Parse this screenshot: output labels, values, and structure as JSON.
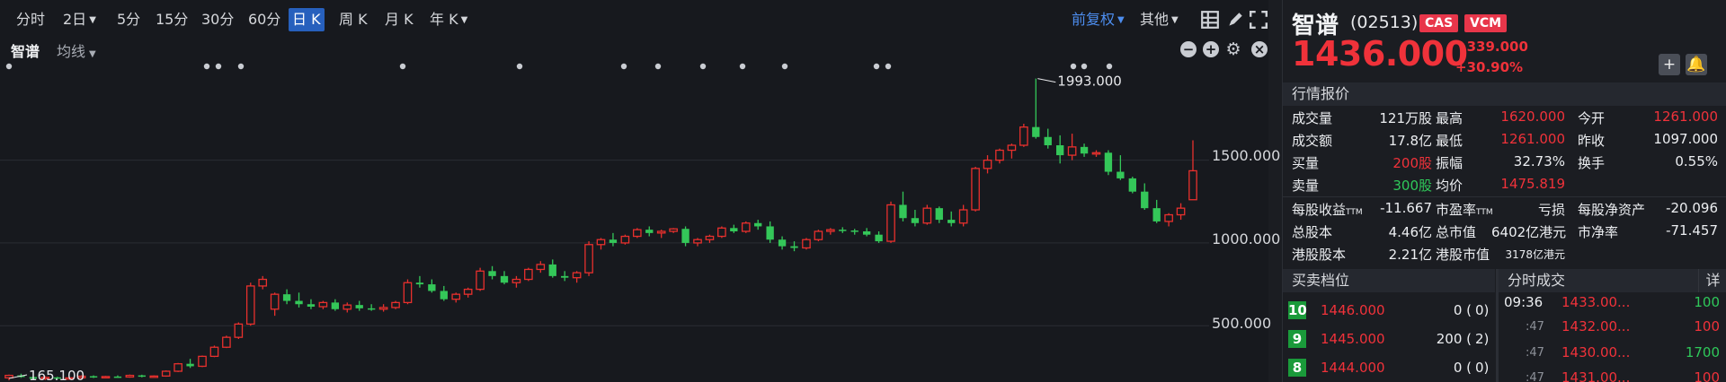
{
  "toolbar": {
    "timeframes": [
      "分时",
      "2日",
      "5分",
      "15分",
      "30分",
      "60分",
      "日 K",
      "周 K",
      "月 K",
      "年 K"
    ],
    "active": "日 K",
    "adjust_label": "前复权",
    "other_label": "其他"
  },
  "chart_header": {
    "name": "智谱",
    "indicator": "均线"
  },
  "chart_data": {
    "type": "candlestick",
    "y_ticks": [
      "1500.000",
      "1000.000",
      "500.000"
    ],
    "ylim": [
      160,
      2110
    ],
    "max_label": "1993.000",
    "min_label": "165.100",
    "up_color": "#e8302d",
    "down_color": "#34c759",
    "candles": [
      [
        185,
        205,
        170,
        200
      ],
      [
        200,
        210,
        185,
        190
      ],
      [
        190,
        195,
        175,
        180
      ],
      [
        180,
        195,
        172,
        188
      ],
      [
        188,
        192,
        178,
        182
      ],
      [
        182,
        190,
        175,
        185
      ],
      [
        185,
        200,
        180,
        195
      ],
      [
        195,
        200,
        184,
        187
      ],
      [
        187,
        197,
        182,
        193
      ],
      [
        193,
        200,
        186,
        190
      ],
      [
        190,
        205,
        186,
        200
      ],
      [
        200,
        204,
        188,
        192
      ],
      [
        192,
        200,
        188,
        196
      ],
      [
        196,
        230,
        192,
        225
      ],
      [
        225,
        275,
        220,
        270
      ],
      [
        270,
        300,
        245,
        255
      ],
      [
        255,
        320,
        250,
        315
      ],
      [
        315,
        380,
        310,
        370
      ],
      [
        370,
        440,
        365,
        430
      ],
      [
        430,
        520,
        420,
        510
      ],
      [
        510,
        760,
        500,
        740
      ],
      [
        740,
        800,
        720,
        780
      ],
      [
        600,
        700,
        560,
        690
      ],
      [
        690,
        720,
        630,
        650
      ],
      [
        650,
        700,
        610,
        630
      ],
      [
        630,
        660,
        600,
        615
      ],
      [
        615,
        650,
        600,
        640
      ],
      [
        640,
        660,
        590,
        600
      ],
      [
        600,
        640,
        580,
        625
      ],
      [
        625,
        650,
        590,
        605
      ],
      [
        605,
        630,
        590,
        600
      ],
      [
        600,
        630,
        585,
        610
      ],
      [
        610,
        650,
        600,
        640
      ],
      [
        640,
        780,
        630,
        760
      ],
      [
        760,
        800,
        730,
        750
      ],
      [
        750,
        780,
        700,
        710
      ],
      [
        710,
        740,
        650,
        660
      ],
      [
        660,
        700,
        640,
        690
      ],
      [
        690,
        730,
        670,
        720
      ],
      [
        720,
        850,
        710,
        830
      ],
      [
        830,
        860,
        780,
        800
      ],
      [
        800,
        830,
        750,
        760
      ],
      [
        760,
        800,
        730,
        780
      ],
      [
        780,
        850,
        770,
        840
      ],
      [
        840,
        890,
        820,
        870
      ],
      [
        870,
        900,
        790,
        800
      ],
      [
        800,
        830,
        770,
        790
      ],
      [
        790,
        830,
        760,
        820
      ],
      [
        820,
        1010,
        800,
        990
      ],
      [
        990,
        1030,
        960,
        1020
      ],
      [
        1020,
        1060,
        980,
        1000
      ],
      [
        1000,
        1050,
        990,
        1040
      ],
      [
        1040,
        1090,
        1030,
        1080
      ],
      [
        1080,
        1100,
        1040,
        1060
      ],
      [
        1060,
        1080,
        1030,
        1070
      ],
      [
        1070,
        1090,
        1060,
        1085
      ],
      [
        1085,
        1100,
        980,
        1000
      ],
      [
        1000,
        1030,
        980,
        1020
      ],
      [
        1020,
        1050,
        1000,
        1040
      ],
      [
        1040,
        1100,
        1030,
        1090
      ],
      [
        1090,
        1110,
        1060,
        1070
      ],
      [
        1070,
        1130,
        1060,
        1120
      ],
      [
        1120,
        1140,
        1080,
        1100
      ],
      [
        1100,
        1130,
        1000,
        1020
      ],
      [
        1020,
        1040,
        960,
        980
      ],
      [
        980,
        1010,
        950,
        970
      ],
      [
        970,
        1030,
        960,
        1020
      ],
      [
        1020,
        1080,
        1010,
        1070
      ],
      [
        1070,
        1090,
        1050,
        1080
      ],
      [
        1080,
        1095,
        1060,
        1075
      ],
      [
        1075,
        1085,
        1050,
        1070
      ],
      [
        1070,
        1090,
        1040,
        1050
      ],
      [
        1050,
        1070,
        1000,
        1010
      ],
      [
        1010,
        1250,
        1000,
        1230
      ],
      [
        1230,
        1310,
        1130,
        1150
      ],
      [
        1150,
        1200,
        1100,
        1120
      ],
      [
        1120,
        1230,
        1110,
        1210
      ],
      [
        1210,
        1220,
        1120,
        1140
      ],
      [
        1140,
        1190,
        1100,
        1120
      ],
      [
        1120,
        1230,
        1100,
        1200
      ],
      [
        1200,
        1460,
        1190,
        1450
      ],
      [
        1450,
        1530,
        1420,
        1500
      ],
      [
        1500,
        1570,
        1480,
        1560
      ],
      [
        1560,
        1600,
        1510,
        1590
      ],
      [
        1590,
        1720,
        1580,
        1700
      ],
      [
        1700,
        1993,
        1630,
        1640
      ],
      [
        1640,
        1690,
        1570,
        1590
      ],
      [
        1590,
        1650,
        1480,
        1530
      ],
      [
        1530,
        1660,
        1500,
        1580
      ],
      [
        1580,
        1600,
        1520,
        1540
      ],
      [
        1540,
        1560,
        1520,
        1545
      ],
      [
        1545,
        1560,
        1410,
        1430
      ],
      [
        1430,
        1530,
        1380,
        1390
      ],
      [
        1390,
        1400,
        1300,
        1310
      ],
      [
        1310,
        1360,
        1200,
        1210
      ],
      [
        1210,
        1260,
        1120,
        1130
      ],
      [
        1130,
        1180,
        1100,
        1170
      ],
      [
        1170,
        1240,
        1140,
        1210
      ],
      [
        1261,
        1620,
        1261,
        1436
      ]
    ]
  },
  "quote": {
    "name": "智谱",
    "code": "(02513)",
    "badges": [
      "CAS",
      "VCM"
    ],
    "price": "1436.000",
    "change": "339.000",
    "change_pct": "+30.90%",
    "section_market": "行情报价",
    "stats": [
      [
        "成交量",
        "121万股",
        "最高",
        "1620.000",
        "今开",
        "1261.000"
      ],
      [
        "成交额",
        "17.8亿",
        "最低",
        "1261.000",
        "昨收",
        "1097.000"
      ],
      [
        "买量",
        "200股",
        "振幅",
        "32.73%",
        "换手",
        "0.55%"
      ],
      [
        "卖量",
        "300股",
        "均价",
        "1475.819",
        "",
        ""
      ]
    ],
    "fin": [
      [
        "每股收益",
        "TTM",
        "-11.667",
        "市盈率",
        "TTM",
        "亏损",
        "每股净资产",
        "-20.096"
      ],
      [
        "总股本",
        "",
        "4.46亿",
        "总市值",
        "",
        "6402亿港元",
        "市净率",
        "-71.457"
      ],
      [
        "港股股本",
        "",
        "2.21亿",
        "港股市值",
        "",
        "3178亿港元",
        "",
        ""
      ]
    ],
    "section_orderbook": "买卖档位",
    "section_ticks": "分时成交",
    "ticks_detail": "详",
    "orderbook": [
      [
        "10",
        "1446.000",
        "0 (",
        "0)"
      ],
      [
        "9",
        "1445.000",
        "200 (",
        "2)"
      ],
      [
        "8",
        "1444.000",
        "0 (",
        "0)"
      ]
    ],
    "ticks": [
      [
        "09:36",
        "1433.00...",
        "100",
        "green"
      ],
      [
        ":47",
        "1432.00...",
        "100",
        "red"
      ],
      [
        ":47",
        "1430.00...",
        "1700",
        "green"
      ],
      [
        ":47",
        "1431.00...",
        "100",
        "red"
      ]
    ]
  }
}
